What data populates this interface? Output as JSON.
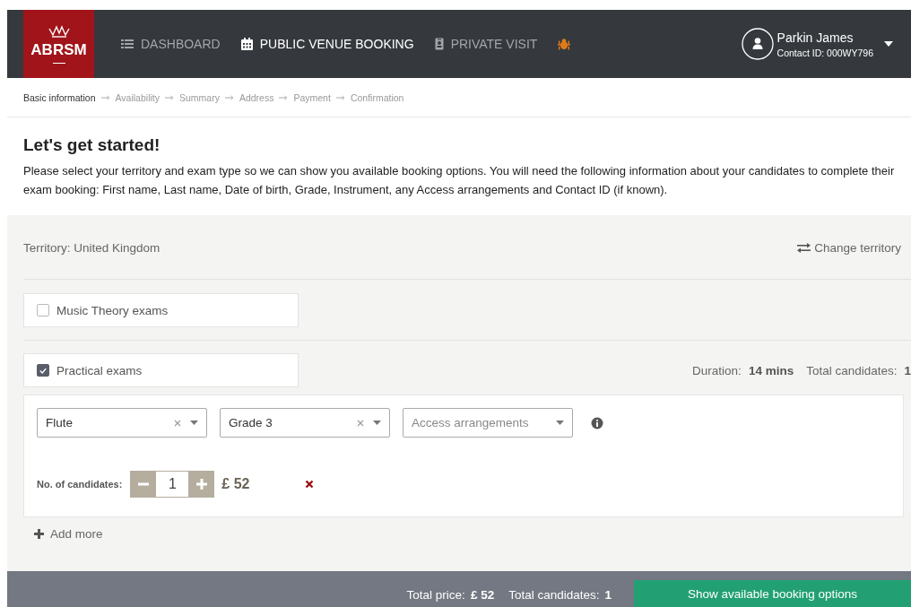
{
  "header": {
    "logo": "ABRSM",
    "nav": [
      {
        "label": "DASHBOARD",
        "selected": false
      },
      {
        "label": "PUBLIC VENUE BOOKING",
        "selected": true
      },
      {
        "label": "PRIVATE VISIT",
        "selected": false
      }
    ],
    "user": {
      "name": "Parkin James",
      "contact_id": "Contact ID: 000WY796"
    }
  },
  "steps": [
    {
      "label": "Basic information",
      "selected": true
    },
    {
      "label": "Availability",
      "selected": false
    },
    {
      "label": "Summary",
      "selected": false
    },
    {
      "label": "Address",
      "selected": false
    },
    {
      "label": "Payment",
      "selected": false
    },
    {
      "label": "Confirmation",
      "selected": false
    }
  ],
  "intro": {
    "title": "Let's get started!",
    "text": "Please select your territory and exam type so we can show you available booking options. You will need the following information about your candidates to complete their exam booking: First name, Last name, Date of birth, Grade, Instrument, any Access arrangements and Contact ID (if known)."
  },
  "territory": {
    "label": "Territory: United Kingdom",
    "action": "Change territory"
  },
  "exam_types": [
    {
      "label": "Music Theory exams",
      "checked": false
    },
    {
      "label": "Practical exams",
      "checked": true
    }
  ],
  "practical_summary": {
    "duration_label": "Duration:",
    "duration": "14 mins",
    "candidates_label": "Total candidates:",
    "candidates": "1"
  },
  "selects": [
    {
      "value": "Flute",
      "clearable": true
    },
    {
      "value": "Grade 3",
      "clearable": true
    },
    {
      "placeholder": "Access arrangements",
      "clearable": false
    }
  ],
  "candidates": {
    "label": "No. of candidates:",
    "value": "1",
    "price": "£ 52"
  },
  "add_more": "Add more",
  "footer": {
    "price_label": "Total price:",
    "price": "£ 52",
    "candidates_label": "Total candidates:",
    "candidates": "1",
    "button": "Show available booking options"
  }
}
